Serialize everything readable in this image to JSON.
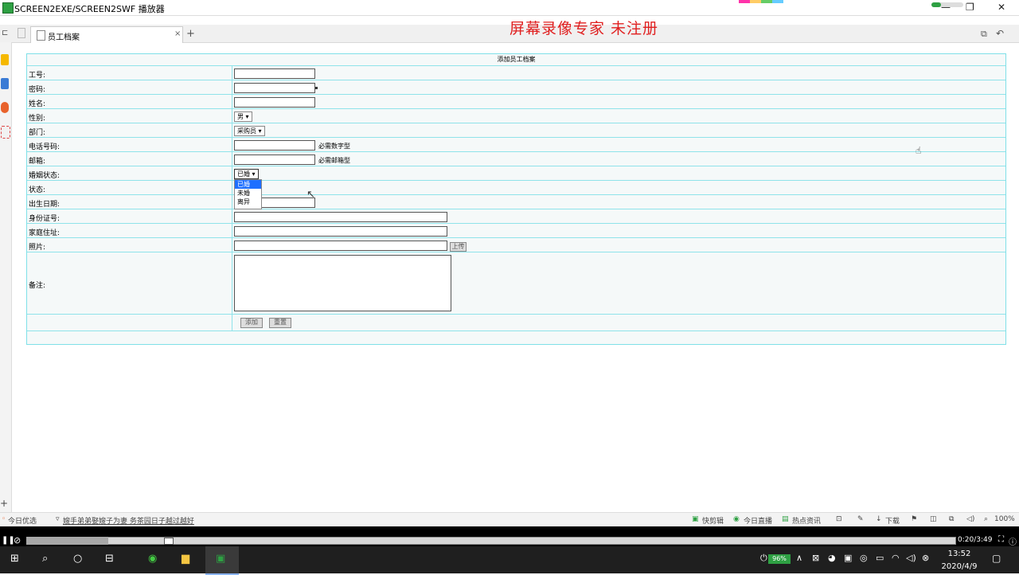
{
  "window": {
    "title": "SCREEN2EXE/SCREEN2SWF 播放器",
    "min": "—",
    "max": "❐",
    "close": "✕"
  },
  "watermark": "屏幕录像专家 未注册",
  "tab": {
    "label": "员工档案",
    "close": "×",
    "add": "+"
  },
  "form": {
    "heading": "添加员工档案",
    "rows": [
      {
        "label": "工号:"
      },
      {
        "label": "密码:"
      },
      {
        "label": "姓名:"
      },
      {
        "label": "性别:"
      },
      {
        "label": "部门:"
      },
      {
        "label": "电话号码:",
        "hint": "必需数字型"
      },
      {
        "label": "邮箱:",
        "hint": "必需邮箱型"
      },
      {
        "label": "婚姻状态:"
      },
      {
        "label": "状态:"
      },
      {
        "label": "出生日期:"
      },
      {
        "label": "身份证号:"
      },
      {
        "label": "家庭住址:"
      },
      {
        "label": "照片:"
      },
      {
        "label": "备注:"
      }
    ],
    "gender_value": "男",
    "dept_value": "采购员",
    "marital_value": "已婚",
    "marital_options": [
      "已婚",
      "未婚",
      "离异"
    ],
    "upload_button": "上传",
    "submit_button": "添加",
    "reset_button": "重置"
  },
  "statusbar": {
    "today": "今日优选",
    "news": "嫂手弟弟娶嫂子为妻 务茶园日子越过越好",
    "right_items": [
      "快剪辑",
      "今日直播",
      "热点资讯"
    ],
    "download": "下载",
    "zoom": "100%"
  },
  "player": {
    "time": "0:20/3:49",
    "progress": 0.088
  },
  "taskbar": {
    "battery": "96%",
    "time": "13:52",
    "date": "2020/4/9"
  },
  "colors": {
    "accent": "#1e6fff",
    "border": "#8fe3ea",
    "watermark": "#e02020"
  }
}
